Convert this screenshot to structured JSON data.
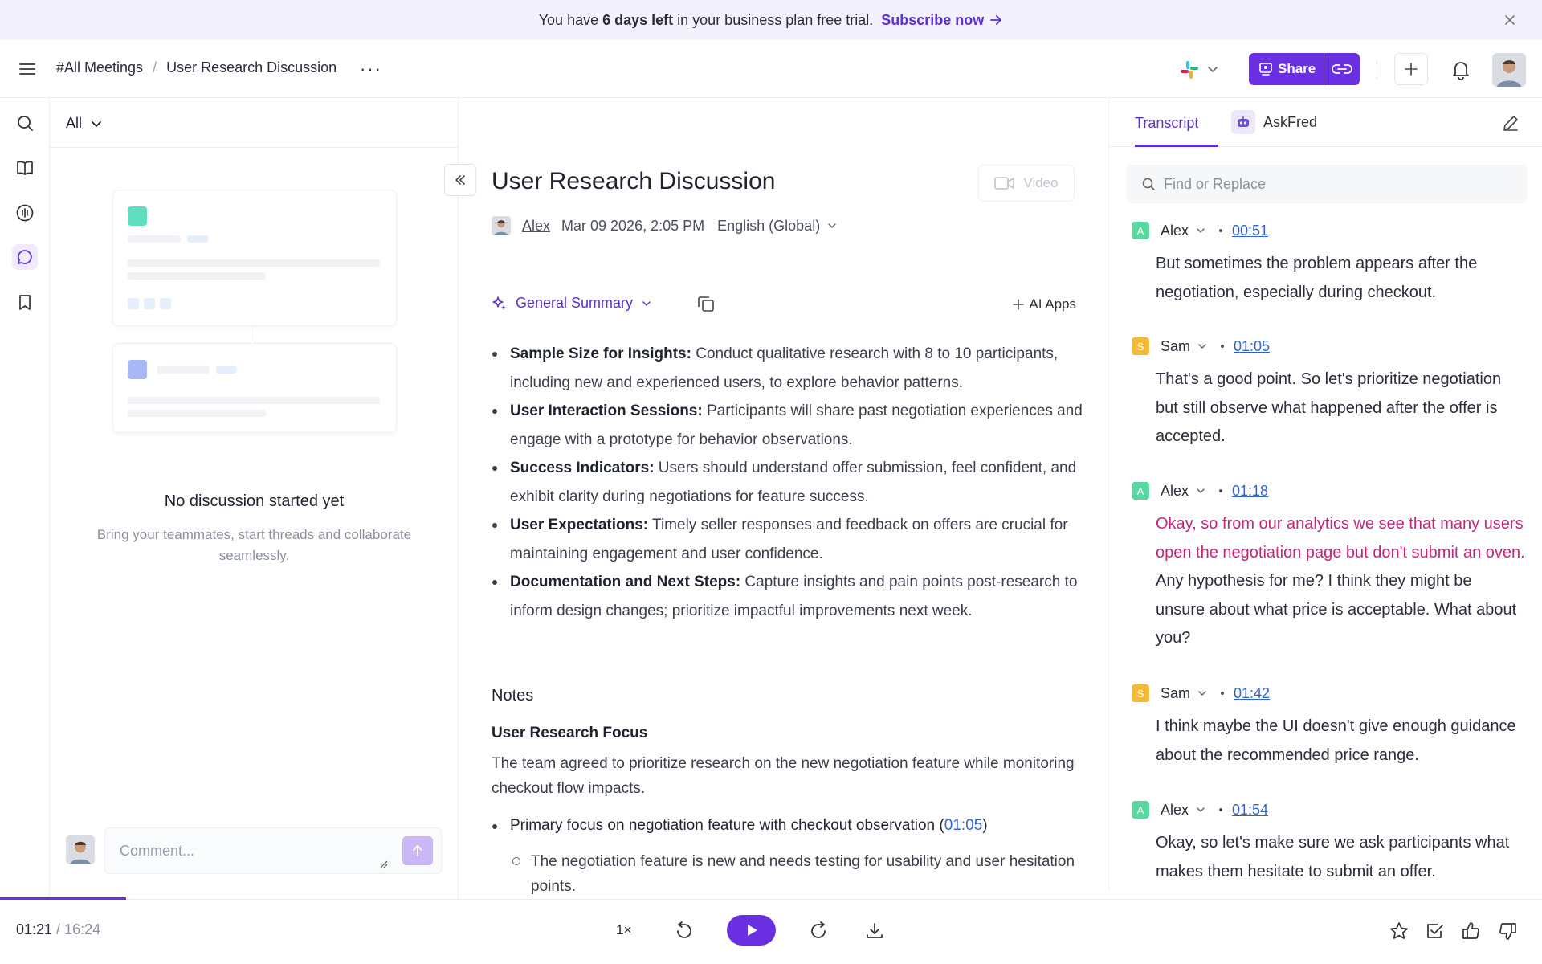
{
  "banner": {
    "text_before": "You have",
    "bold": "6 days left",
    "text_after": "in your business plan free trial.",
    "link": "Subscribe now"
  },
  "header": {
    "breadcrumb_root": "#All Meetings",
    "breadcrumb_sep": "/",
    "breadcrumb_current": "User Research Discussion",
    "more": "···",
    "share_label": "Share"
  },
  "discussion": {
    "filter": "All",
    "empty_title": "No discussion started yet",
    "empty_sub": "Bring your teammates, start threads and collaborate seamlessly.",
    "comment_placeholder": "Comment..."
  },
  "meeting": {
    "title": "User Research Discussion",
    "video_label": "Video",
    "author": "Alex",
    "date": "Mar 09 2026, 2:05 PM",
    "language": "English (Global)",
    "summary_label": "General Summary",
    "ai_apps": "AI Apps",
    "bullets": [
      {
        "term": "Sample Size for Insights:",
        "text": " Conduct qualitative research with 8 to 10 participants, including new and experienced users, to explore behavior patterns."
      },
      {
        "term": "User Interaction Sessions:",
        "text": " Participants will share past negotiation experiences and engage with a prototype for behavior observations."
      },
      {
        "term": "Success Indicators:",
        "text": " Users should understand offer submission, feel confident, and exhibit clarity during negotiations for feature success."
      },
      {
        "term": "User Expectations:",
        "text": " Timely seller responses and feedback on offers are crucial for maintaining engagement and user confidence."
      },
      {
        "term": "Documentation and Next Steps:",
        "text": " Capture insights and pain points post-research to inform design changes; prioritize impactful improvements next week."
      }
    ],
    "notes_heading": "Notes",
    "notes_subheading": "User Research Focus",
    "notes_paragraph": "The team agreed to prioritize research on the new negotiation feature while monitoring checkout flow impacts.",
    "focus_text": "Primary focus on negotiation feature with checkout observation (",
    "focus_time": "01:05",
    "focus_close": ")",
    "focus_sub": "The negotiation feature is new and needs testing for usability and user hesitation points."
  },
  "transcript": {
    "tab_transcript": "Transcript",
    "tab_askfred": "AskFred",
    "search_placeholder": "Find or Replace",
    "entries": [
      {
        "initial": "A",
        "speaker": "Alex",
        "time": "00:51",
        "color": "#5ad6a0",
        "highlight": "",
        "text": "But sometimes the problem appears after the negotiation, especially during checkout."
      },
      {
        "initial": "S",
        "speaker": "Sam",
        "time": "01:05",
        "color": "#f5b93a",
        "highlight": "",
        "text": "That's a good point. So let's prioritize negotiation but still observe what happened after the offer is accepted."
      },
      {
        "initial": "A",
        "speaker": "Alex",
        "time": "01:18",
        "color": "#5ad6a0",
        "highlight": "Okay, so from our analytics we see that many users open the negotiation page but don't submit an oven.",
        "text": " Any hypothesis for me? I think they might be unsure about what price is acceptable. What about you?"
      },
      {
        "initial": "S",
        "speaker": "Sam",
        "time": "01:42",
        "color": "#f5b93a",
        "highlight": "",
        "text": "I think maybe the UI doesn't give enough guidance about the recommended price range."
      },
      {
        "initial": "A",
        "speaker": "Alex",
        "time": "01:54",
        "color": "#5ad6a0",
        "highlight": "",
        "text": "Okay, so let's make sure we ask participants what makes them hesitate to submit an offer."
      }
    ]
  },
  "player": {
    "current": "01:21",
    "sep": " / ",
    "total": "16:24",
    "speed": "1×",
    "progress": 0.082
  },
  "colors": {
    "accent": "#6a2fe0",
    "link": "#2f64d6",
    "highlight": "#c8247a"
  }
}
